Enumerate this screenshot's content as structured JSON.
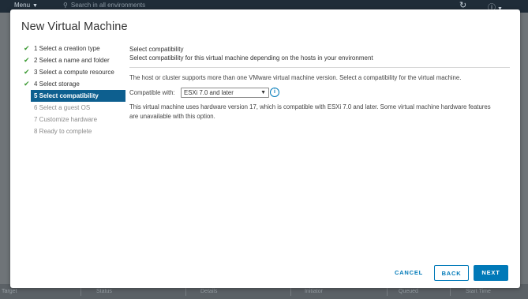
{
  "topbar": {
    "menu_label": "Menu",
    "search_placeholder": "Search in all environments"
  },
  "bottombar": {
    "columns": [
      "Target",
      "Status",
      "Details",
      "Initiator",
      "Queued",
      "Start Time"
    ]
  },
  "dialog": {
    "title": "New Virtual Machine",
    "steps": [
      {
        "label": "1 Select a creation type",
        "state": "done"
      },
      {
        "label": "2 Select a name and folder",
        "state": "done"
      },
      {
        "label": "3 Select a compute resource",
        "state": "done"
      },
      {
        "label": "4 Select storage",
        "state": "done"
      },
      {
        "label": "5 Select compatibility",
        "state": "active"
      },
      {
        "label": "6 Select a guest OS",
        "state": "future"
      },
      {
        "label": "7 Customize hardware",
        "state": "future"
      },
      {
        "label": "8 Ready to complete",
        "state": "future"
      }
    ],
    "content": {
      "heading": "Select compatibility",
      "subheading": "Select compatibility for this virtual machine depending on the hosts in your environment",
      "paragraph1": "The host or cluster supports more than one VMware virtual machine version. Select a compatibility for the virtual machine.",
      "compatible_label": "Compatible with:",
      "compatible_value": "ESXi 7.0 and later",
      "paragraph2": "This virtual machine uses hardware version 17, which is compatible with ESXi 7.0 and later. Some virtual machine hardware features are unavailable with this option."
    },
    "buttons": {
      "cancel": "CANCEL",
      "back": "BACK",
      "next": "NEXT"
    }
  },
  "colors": {
    "accent": "#0079b8",
    "active_step_bg": "#0d5f8f",
    "check": "#3d9b35"
  }
}
